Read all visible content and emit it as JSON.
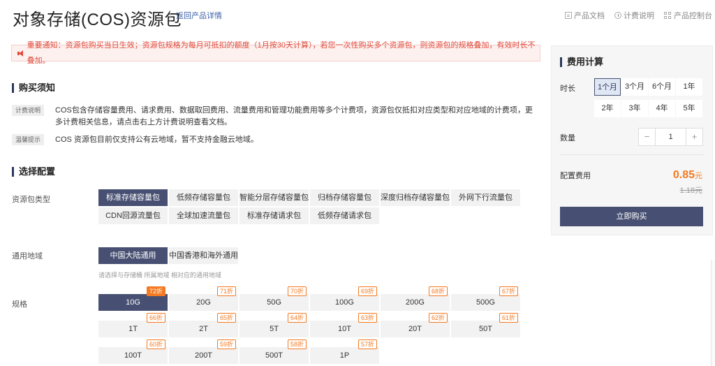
{
  "header": {
    "title": "对象存储(COS)资源包",
    "back_link": "返回产品详情",
    "links": [
      {
        "label": "产品文档",
        "icon": "document-icon"
      },
      {
        "label": "计费说明",
        "icon": "info-icon"
      },
      {
        "label": "产品控制台",
        "icon": "console-grid-icon"
      }
    ]
  },
  "notice": {
    "text": "重要通知：资源包购买当日生效；资源包规格为每月可抵扣的额度（1月按30天计算），若您一次性购买多个资源包，则资源包的规格叠加，有效时长不叠加。"
  },
  "purchase_notes": {
    "title": "购买须知",
    "items": [
      {
        "tag": "计费说明",
        "text": "COS包含存储容量费用、请求费用、数据取回费用、流量费用和管理功能费用等多个计费项，资源包仅抵扣对应类型和对应地域的计费项，更多计费相关信息，请点击右上方计费说明查看文档。"
      },
      {
        "tag": "温馨提示",
        "text": "COS 资源包目前仅支持公有云地域，暂不支持金融云地域。"
      }
    ]
  },
  "config": {
    "title": "选择配置",
    "type_label": "资源包类型",
    "types": [
      {
        "label": "标准存储容量包",
        "selected": true
      },
      {
        "label": "低频存储容量包",
        "selected": false
      },
      {
        "label": "智能分层存储容量包",
        "selected": false
      },
      {
        "label": "归档存储容量包",
        "selected": false
      },
      {
        "label": "深度归档存储容量包",
        "selected": false
      },
      {
        "label": "外网下行流量包",
        "selected": false
      },
      {
        "label": "CDN回源流量包",
        "selected": false
      },
      {
        "label": "全球加速流量包",
        "selected": false
      },
      {
        "label": "标准存储请求包",
        "selected": false
      },
      {
        "label": "低频存储请求包",
        "selected": false
      }
    ],
    "region_label": "通用地域",
    "regions": [
      {
        "label": "中国大陆通用",
        "selected": true
      },
      {
        "label": "中国香港和海外通用",
        "selected": false
      }
    ],
    "region_hint": "请选择与存储桶 所属地域 相对应的通用地域",
    "spec_label": "规格",
    "specs": [
      {
        "label": "10G",
        "discount": "72折",
        "selected": true
      },
      {
        "label": "20G",
        "discount": "71折",
        "selected": false
      },
      {
        "label": "50G",
        "discount": "70折",
        "selected": false
      },
      {
        "label": "100G",
        "discount": "69折",
        "selected": false
      },
      {
        "label": "200G",
        "discount": "68折",
        "selected": false
      },
      {
        "label": "500G",
        "discount": "67折",
        "selected": false
      },
      {
        "label": "1T",
        "discount": "66折",
        "selected": false
      },
      {
        "label": "2T",
        "discount": "65折",
        "selected": false
      },
      {
        "label": "5T",
        "discount": "64折",
        "selected": false
      },
      {
        "label": "10T",
        "discount": "63折",
        "selected": false
      },
      {
        "label": "20T",
        "discount": "62折",
        "selected": false
      },
      {
        "label": "50T",
        "discount": "61折",
        "selected": false
      },
      {
        "label": "100T",
        "discount": "60折",
        "selected": false
      },
      {
        "label": "200T",
        "discount": "59折",
        "selected": false
      },
      {
        "label": "500T",
        "discount": "58折",
        "selected": false
      },
      {
        "label": "1P",
        "discount": "57折",
        "selected": false
      }
    ]
  },
  "calculator": {
    "title": "费用计算",
    "duration_label": "时长",
    "durations": [
      {
        "label": "1个月",
        "selected": true
      },
      {
        "label": "3个月",
        "selected": false
      },
      {
        "label": "6个月",
        "selected": false
      },
      {
        "label": "1年",
        "selected": false
      },
      {
        "label": "2年",
        "selected": false
      },
      {
        "label": "3年",
        "selected": false
      },
      {
        "label": "4年",
        "selected": false
      },
      {
        "label": "5年",
        "selected": false
      }
    ],
    "quantity_label": "数量",
    "quantity": "1",
    "minus": "−",
    "plus": "+",
    "fee_label": "配置费用",
    "price": "0.85",
    "unit": "元",
    "original_price": "1.18元",
    "buy_button": "立即购买"
  },
  "colors": {
    "primary": "#475072",
    "accent": "#f47920",
    "notice_text": "#e0493a"
  }
}
